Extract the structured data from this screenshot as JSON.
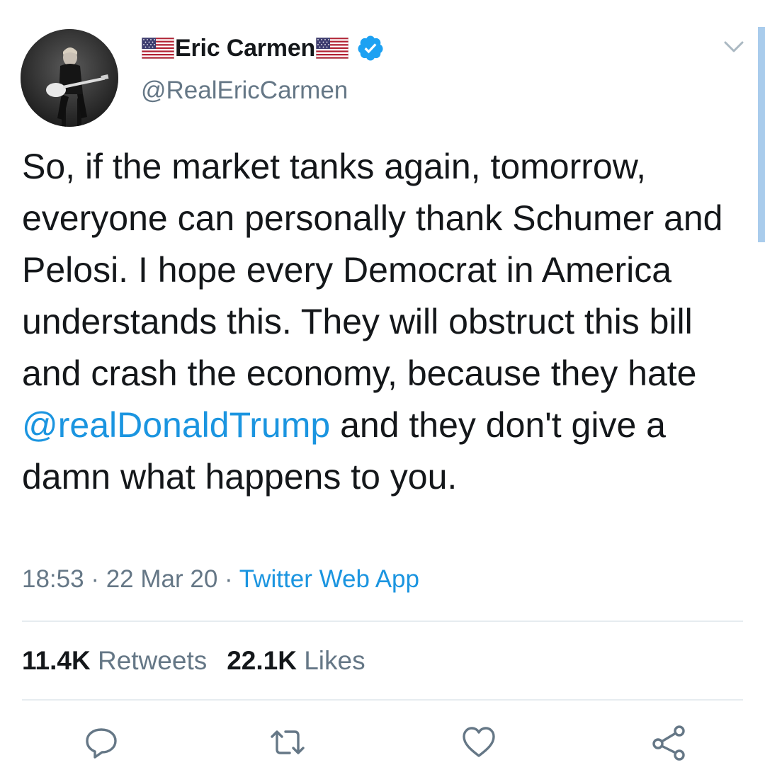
{
  "author": {
    "display_name": "Eric Carmen",
    "handle": "@RealEricCarmen",
    "flag_icon": "us-flag-icon",
    "verified_icon": "verified-badge-icon"
  },
  "tweet": {
    "text_before_mention": "So, if the market tanks again, tomorrow, everyone can personally thank Schumer and Pelosi. I hope every Democrat in America understands this. They will obstruct this bill and crash the economy, because they hate ",
    "mention": "@realDonaldTrump",
    "text_after_mention": " and they don't give a damn what happens to you."
  },
  "meta": {
    "time": "18:53",
    "separator": "·",
    "date": "22 Mar 20",
    "source": "Twitter Web App"
  },
  "stats": {
    "retweets_count": "11.4K",
    "retweets_label": "Retweets",
    "likes_count": "22.1K",
    "likes_label": "Likes"
  },
  "actions": [
    {
      "icon": "reply-icon"
    },
    {
      "icon": "retweet-icon"
    },
    {
      "icon": "like-icon"
    },
    {
      "icon": "share-icon"
    }
  ],
  "colors": {
    "link": "#1b95e0",
    "secondary_text": "#657786",
    "primary_text": "#14171a",
    "verified": "#1da1f2",
    "divider": "#e6ecf0",
    "scrollbar": "#a9ccec"
  }
}
